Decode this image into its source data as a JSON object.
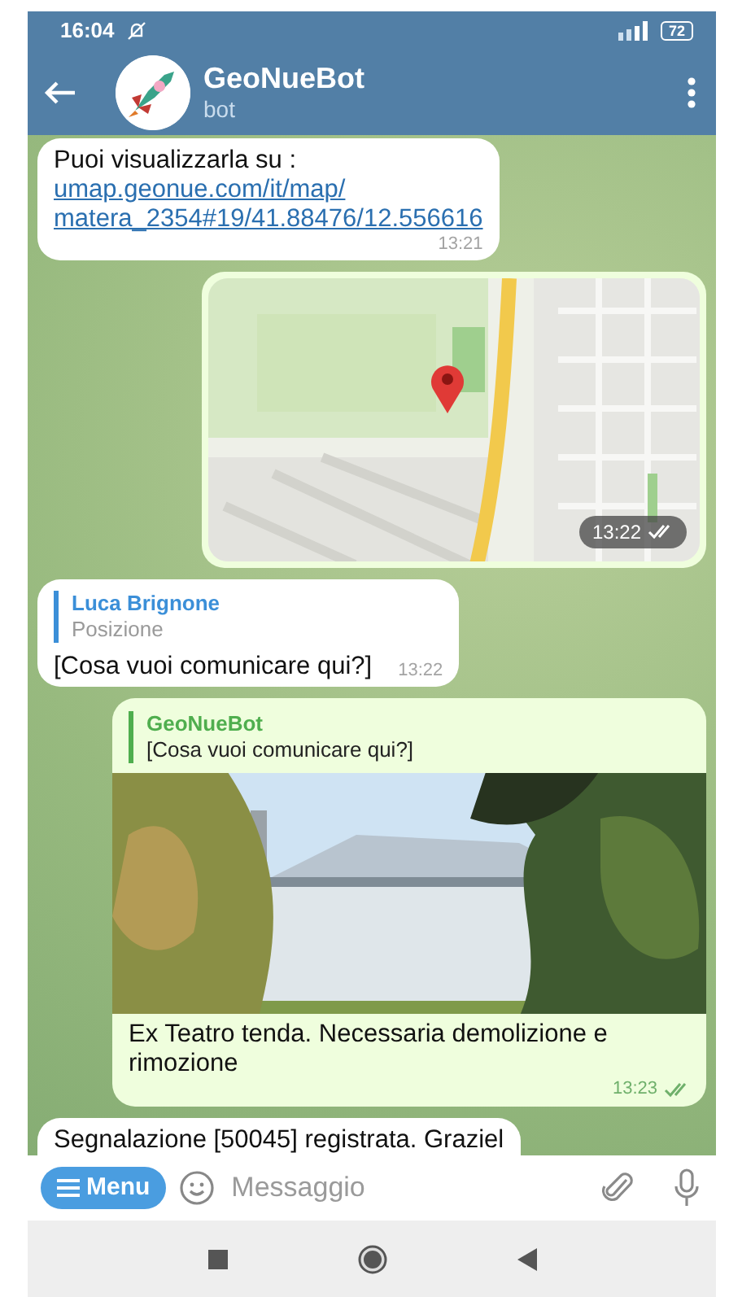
{
  "status_bar": {
    "time": "16:04",
    "battery": "72"
  },
  "header": {
    "title": "GeoNueBot",
    "subtitle": "bot"
  },
  "messages": [
    {
      "kind": "text",
      "outgoing": false,
      "text": "Puoi visualizzarla su :",
      "link_lines": [
        "umap.geonue.com/it/map/",
        "matera_2354#19/41.88476/12.556616"
      ],
      "time": "13:21"
    },
    {
      "kind": "location",
      "outgoing": true,
      "time": "13:22",
      "read": true
    },
    {
      "kind": "text",
      "outgoing": false,
      "reply": {
        "author": "Luca Brignone",
        "text": "Posizione",
        "color": "#3b8fd8"
      },
      "text": "[Cosa vuoi comunicare qui?]",
      "time": "13:22"
    },
    {
      "outgoing": true,
      "reply": {
        "author": "GeoNueBot",
        "text": "[Cosa vuoi comunicare qui?]",
        "color": "#4fae4e"
      },
      "caption": "Ex Teatro tenda. Necessaria demolizione e rimozione",
      "time": "13:23",
      "read": true
    },
    {
      "kind": "text",
      "outgoing": false,
      "text": "Segnalazione [50045] registrata. Graziel"
    }
  ],
  "composer": {
    "menu_label": "Menu",
    "placeholder": "Messaggio"
  }
}
